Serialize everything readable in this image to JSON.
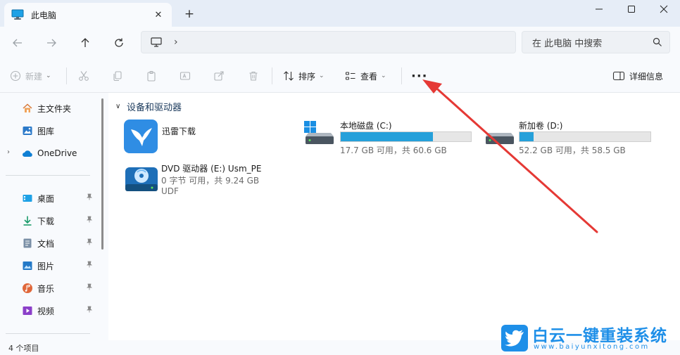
{
  "tab": {
    "title": "此电脑",
    "close": "✕",
    "new_tab": "+"
  },
  "window_controls": {
    "minimize": "—",
    "maximize": "☐",
    "close": "✕"
  },
  "navigation": {
    "back": "back-arrow",
    "forward": "forward-arrow",
    "up": "up-arrow",
    "refresh": "refresh-icon",
    "address_chevron": "›",
    "search_placeholder": "在 此电脑 中搜索"
  },
  "commandbar": {
    "new_label": "新建",
    "sort_label": "排序",
    "view_label": "查看",
    "more_label": "···",
    "details_label": "详细信息",
    "caret": "⌄"
  },
  "sidebar": {
    "quick": [
      {
        "label": "主文件夹",
        "icon": "home-icon"
      },
      {
        "label": "图库",
        "icon": "gallery-icon"
      },
      {
        "label": "OneDrive",
        "icon": "cloud-icon",
        "expander": "›"
      }
    ],
    "pinned": [
      {
        "label": "桌面",
        "icon": "desktop-icon"
      },
      {
        "label": "下载",
        "icon": "download-icon"
      },
      {
        "label": "文档",
        "icon": "document-icon"
      },
      {
        "label": "图片",
        "icon": "pictures-icon"
      },
      {
        "label": "音乐",
        "icon": "music-icon"
      },
      {
        "label": "视频",
        "icon": "video-icon"
      }
    ],
    "pin_glyph": "📌"
  },
  "content": {
    "group_title": "设备和驱动器",
    "group_chevron": "∨",
    "items": [
      {
        "name": "迅雷下载",
        "icon": "thunder-icon"
      },
      {
        "name": "本地磁盘 (C:)",
        "sub": "17.7 GB 可用，共 60.6 GB",
        "used_fraction": 0.708,
        "icon": "windows-drive-icon"
      },
      {
        "name": "新加卷 (D:)",
        "sub": "52.2 GB 可用，共 58.5 GB",
        "used_fraction": 0.108,
        "icon": "drive-icon"
      },
      {
        "name": "DVD 驱动器 (E:) Usm_PE",
        "sub": "0 字节 可用，共 9.24 GB",
        "sub2": "UDF",
        "icon": "dvd-icon"
      }
    ]
  },
  "status": {
    "count": "4 个项目"
  },
  "watermark": {
    "text": "白云一键重装系统",
    "url": "www.baiyunxitong.com"
  },
  "colors": {
    "accent": "#26a0da",
    "annotation": "#e53935",
    "watermark": "#1e8fe8"
  }
}
